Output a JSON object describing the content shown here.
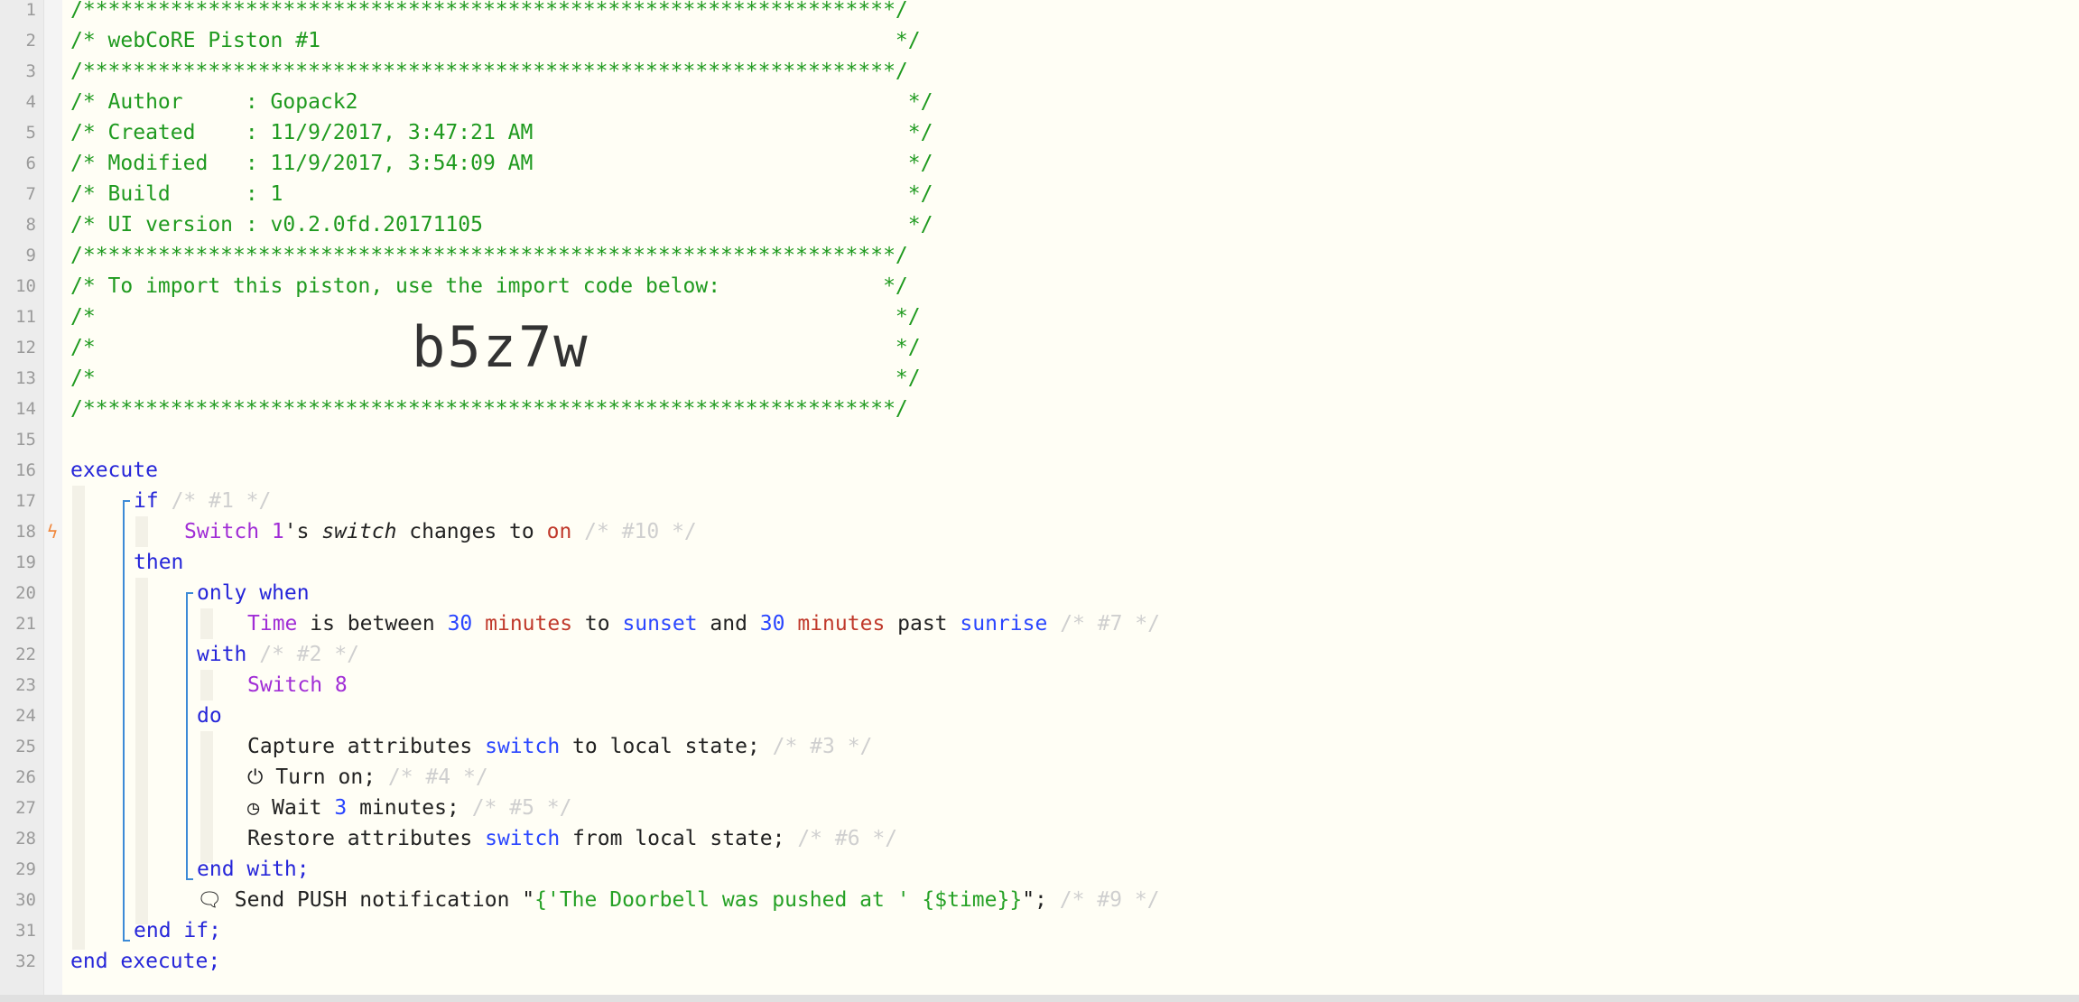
{
  "line_numbers": [
    "1",
    "2",
    "3",
    "4",
    "5",
    "6",
    "7",
    "8",
    "9",
    "10",
    "11",
    "12",
    "13",
    "14",
    "15",
    "16",
    "17",
    "18",
    "19",
    "20",
    "21",
    "22",
    "23",
    "24",
    "25",
    "26",
    "27",
    "28",
    "29",
    "30",
    "31",
    "32"
  ],
  "header": {
    "stars_line": "/*****************************************************************/",
    "title_line": "/* webCoRE Piston #1                                              */",
    "author_line": "/* Author     : Gopack2                                            */",
    "created_line": "/* Created    : 11/9/2017, 3:47:21 AM                              */",
    "modified_line": "/* Modified   : 11/9/2017, 3:54:09 AM                              */",
    "build_line": "/* Build      : 1                                                  */",
    "ui_line": "/* UI version : v0.2.0fd.20171105                                  */",
    "import_line": "/* To import this piston, use the import code below:             */",
    "empty_line": "/*                                                                */",
    "import_code": "b5z7w"
  },
  "code": {
    "execute": "execute",
    "if": "if",
    "if_ph": "/* #1 */",
    "trigger_device": "Switch 1",
    "trigger_poss": "'s ",
    "trigger_attr": "switch",
    "trigger_op": " changes to ",
    "trigger_value": "on",
    "trigger_ph": "/* #10 */",
    "then": "then",
    "only_when": "only when",
    "time": "Time",
    "is_between": " is between ",
    "n30a": "30",
    "minutes_a": "minutes",
    "to": " to ",
    "sunset": "sunset",
    "and": " and ",
    "n30b": "30",
    "minutes_b": "minutes",
    "past": " past ",
    "sunrise": "sunrise",
    "cond_ph": "/* #7 */",
    "with": "with",
    "with_ph": "/* #2 */",
    "with_device": "Switch 8",
    "do": "do",
    "capture": "Capture attributes ",
    "capture_attr": "switch",
    "capture_rest": " to local state;",
    "capture_ph": "/* #3 */",
    "turn_on": "Turn on;",
    "turn_on_ph": "/* #4 */",
    "wait": "Wait ",
    "wait_num": "3",
    "wait_rest": " minutes;",
    "wait_ph": "/* #5 */",
    "restore": "Restore attributes ",
    "restore_attr": "switch",
    "restore_rest": " from local state;",
    "restore_ph": "/* #6 */",
    "end_with": "end with;",
    "send": "Send PUSH notification \"",
    "send_str": "{'The Doorbell was pushed at ' {$time}}",
    "send_end": "\";",
    "send_ph": "/* #9 */",
    "end_if": "end if;",
    "end_execute": "end execute;"
  },
  "icons": {
    "trigger": "lightning-icon",
    "power": "power-icon",
    "clock": "clock-icon",
    "message": "speech-bubble-icon"
  }
}
